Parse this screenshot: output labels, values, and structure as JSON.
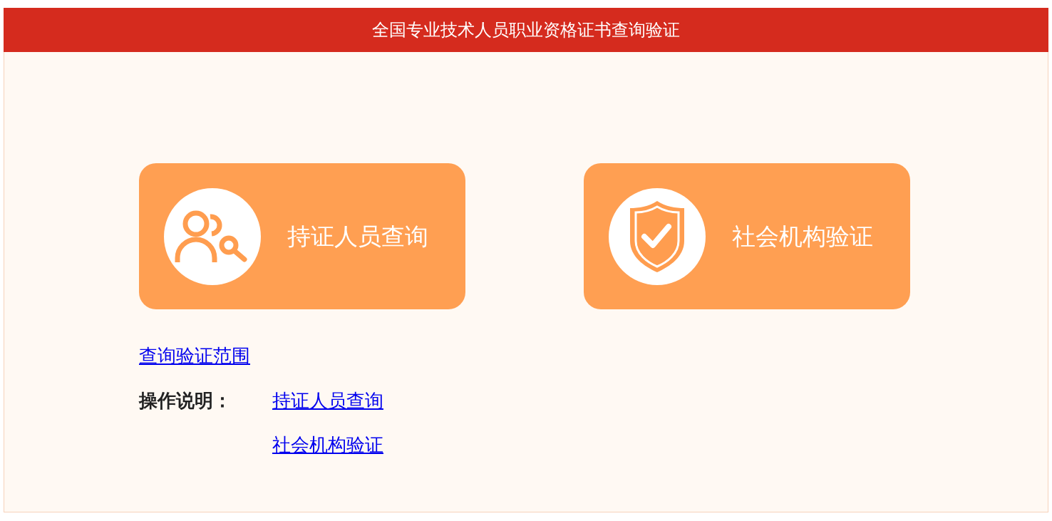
{
  "header": {
    "title": "全国专业技术人员职业资格证书查询验证"
  },
  "cards": [
    {
      "kind": "query",
      "label": "持证人员查询"
    },
    {
      "kind": "verify",
      "label": "社会机构验证"
    }
  ],
  "scope_link": "查询验证范围",
  "instructions": {
    "label": "操作说明：",
    "links": [
      "持证人员查询",
      "社会机构验证"
    ]
  }
}
